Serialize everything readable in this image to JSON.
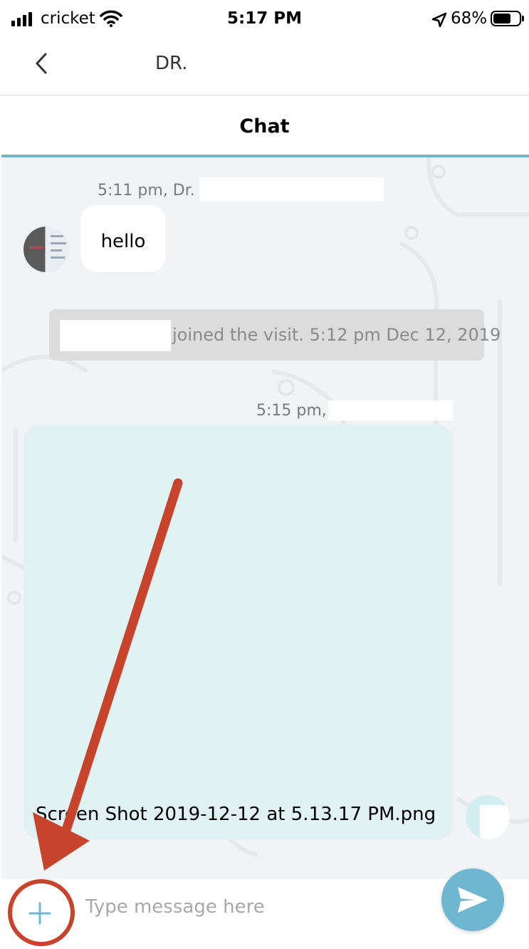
{
  "status_bar": {
    "carrier": "cricket",
    "time": "5:17 PM",
    "battery": "68%",
    "battery_level": 0.68
  },
  "nav": {
    "title": "DR."
  },
  "tab": {
    "label": "Chat"
  },
  "messages": {
    "incoming": {
      "meta": "5:11 pm, Dr.",
      "text": "hello"
    },
    "system": {
      "text": "joined the visit. 5:12 pm Dec 12, 2019"
    },
    "outgoing": {
      "meta": "5:15 pm,",
      "attachment": "Screen Shot 2019-12-12 at 5.13.17 PM.png"
    }
  },
  "composer": {
    "placeholder": "Type message here"
  },
  "colors": {
    "accent": "#6fb6d0",
    "annotation": "#c8432c",
    "outgoing_bubble": "#e0f2f2"
  },
  "icons": [
    "back-chevron-icon",
    "plus-icon",
    "send-icon",
    "signal-icon",
    "wifi-icon",
    "location-arrow-icon",
    "battery-icon"
  ]
}
